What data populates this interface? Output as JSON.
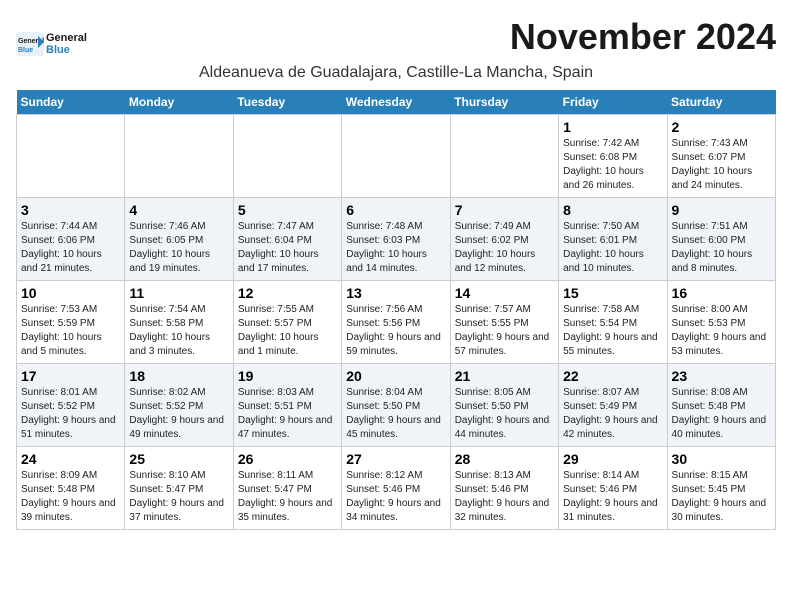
{
  "logo": {
    "text_general": "General",
    "text_blue": "Blue"
  },
  "title": "November 2024",
  "location": "Aldeanueva de Guadalajara, Castille-La Mancha, Spain",
  "days_of_week": [
    "Sunday",
    "Monday",
    "Tuesday",
    "Wednesday",
    "Thursday",
    "Friday",
    "Saturday"
  ],
  "weeks": [
    [
      {
        "day": "",
        "info": ""
      },
      {
        "day": "",
        "info": ""
      },
      {
        "day": "",
        "info": ""
      },
      {
        "day": "",
        "info": ""
      },
      {
        "day": "",
        "info": ""
      },
      {
        "day": "1",
        "info": "Sunrise: 7:42 AM\nSunset: 6:08 PM\nDaylight: 10 hours and 26 minutes."
      },
      {
        "day": "2",
        "info": "Sunrise: 7:43 AM\nSunset: 6:07 PM\nDaylight: 10 hours and 24 minutes."
      }
    ],
    [
      {
        "day": "3",
        "info": "Sunrise: 7:44 AM\nSunset: 6:06 PM\nDaylight: 10 hours and 21 minutes."
      },
      {
        "day": "4",
        "info": "Sunrise: 7:46 AM\nSunset: 6:05 PM\nDaylight: 10 hours and 19 minutes."
      },
      {
        "day": "5",
        "info": "Sunrise: 7:47 AM\nSunset: 6:04 PM\nDaylight: 10 hours and 17 minutes."
      },
      {
        "day": "6",
        "info": "Sunrise: 7:48 AM\nSunset: 6:03 PM\nDaylight: 10 hours and 14 minutes."
      },
      {
        "day": "7",
        "info": "Sunrise: 7:49 AM\nSunset: 6:02 PM\nDaylight: 10 hours and 12 minutes."
      },
      {
        "day": "8",
        "info": "Sunrise: 7:50 AM\nSunset: 6:01 PM\nDaylight: 10 hours and 10 minutes."
      },
      {
        "day": "9",
        "info": "Sunrise: 7:51 AM\nSunset: 6:00 PM\nDaylight: 10 hours and 8 minutes."
      }
    ],
    [
      {
        "day": "10",
        "info": "Sunrise: 7:53 AM\nSunset: 5:59 PM\nDaylight: 10 hours and 5 minutes."
      },
      {
        "day": "11",
        "info": "Sunrise: 7:54 AM\nSunset: 5:58 PM\nDaylight: 10 hours and 3 minutes."
      },
      {
        "day": "12",
        "info": "Sunrise: 7:55 AM\nSunset: 5:57 PM\nDaylight: 10 hours and 1 minute."
      },
      {
        "day": "13",
        "info": "Sunrise: 7:56 AM\nSunset: 5:56 PM\nDaylight: 9 hours and 59 minutes."
      },
      {
        "day": "14",
        "info": "Sunrise: 7:57 AM\nSunset: 5:55 PM\nDaylight: 9 hours and 57 minutes."
      },
      {
        "day": "15",
        "info": "Sunrise: 7:58 AM\nSunset: 5:54 PM\nDaylight: 9 hours and 55 minutes."
      },
      {
        "day": "16",
        "info": "Sunrise: 8:00 AM\nSunset: 5:53 PM\nDaylight: 9 hours and 53 minutes."
      }
    ],
    [
      {
        "day": "17",
        "info": "Sunrise: 8:01 AM\nSunset: 5:52 PM\nDaylight: 9 hours and 51 minutes."
      },
      {
        "day": "18",
        "info": "Sunrise: 8:02 AM\nSunset: 5:52 PM\nDaylight: 9 hours and 49 minutes."
      },
      {
        "day": "19",
        "info": "Sunrise: 8:03 AM\nSunset: 5:51 PM\nDaylight: 9 hours and 47 minutes."
      },
      {
        "day": "20",
        "info": "Sunrise: 8:04 AM\nSunset: 5:50 PM\nDaylight: 9 hours and 45 minutes."
      },
      {
        "day": "21",
        "info": "Sunrise: 8:05 AM\nSunset: 5:50 PM\nDaylight: 9 hours and 44 minutes."
      },
      {
        "day": "22",
        "info": "Sunrise: 8:07 AM\nSunset: 5:49 PM\nDaylight: 9 hours and 42 minutes."
      },
      {
        "day": "23",
        "info": "Sunrise: 8:08 AM\nSunset: 5:48 PM\nDaylight: 9 hours and 40 minutes."
      }
    ],
    [
      {
        "day": "24",
        "info": "Sunrise: 8:09 AM\nSunset: 5:48 PM\nDaylight: 9 hours and 39 minutes."
      },
      {
        "day": "25",
        "info": "Sunrise: 8:10 AM\nSunset: 5:47 PM\nDaylight: 9 hours and 37 minutes."
      },
      {
        "day": "26",
        "info": "Sunrise: 8:11 AM\nSunset: 5:47 PM\nDaylight: 9 hours and 35 minutes."
      },
      {
        "day": "27",
        "info": "Sunrise: 8:12 AM\nSunset: 5:46 PM\nDaylight: 9 hours and 34 minutes."
      },
      {
        "day": "28",
        "info": "Sunrise: 8:13 AM\nSunset: 5:46 PM\nDaylight: 9 hours and 32 minutes."
      },
      {
        "day": "29",
        "info": "Sunrise: 8:14 AM\nSunset: 5:46 PM\nDaylight: 9 hours and 31 minutes."
      },
      {
        "day": "30",
        "info": "Sunrise: 8:15 AM\nSunset: 5:45 PM\nDaylight: 9 hours and 30 minutes."
      }
    ]
  ]
}
